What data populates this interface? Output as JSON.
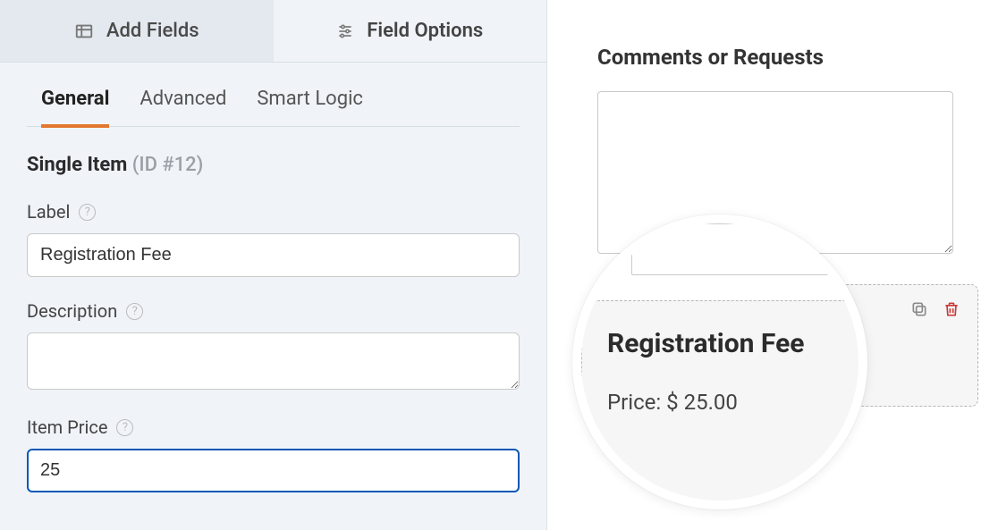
{
  "topTabs": {
    "addFields": "Add Fields",
    "fieldOptions": "Field Options"
  },
  "subTabs": {
    "general": "General",
    "advanced": "Advanced",
    "smartLogic": "Smart Logic"
  },
  "fieldTitle": {
    "name": "Single Item",
    "id": "(ID #12)"
  },
  "form": {
    "labelLabel": "Label",
    "labelValue": "Registration Fee",
    "descriptionLabel": "Description",
    "descriptionValue": "",
    "itemPriceLabel": "Item Price",
    "itemPriceValue": "25"
  },
  "preview": {
    "commentsLabel": "Comments or Requests",
    "regTitle": "Registration Fee",
    "priceLine": "Price: $ 25.00"
  }
}
